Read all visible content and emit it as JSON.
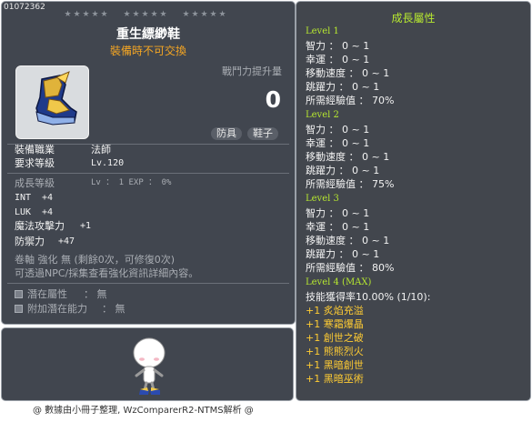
{
  "item": {
    "id": "01072362",
    "name": "重生縹緲鞋",
    "trade_note": "裝備時不可交換",
    "icon": "boots-icon",
    "power_label": "戰鬥力提升量",
    "power_value": "0",
    "tags": [
      "防具",
      "鞋子"
    ]
  },
  "requirements": {
    "job_label": "裝備職業",
    "job_value": "法師",
    "level_label": "要求等級",
    "level_value": "Lv.120"
  },
  "growth_summary": {
    "label": "成長等級",
    "value": "Lv ： 1   EXP ： 0%"
  },
  "stats": [
    {
      "name": "INT",
      "value": "+4"
    },
    {
      "name": "LUK",
      "value": "+4"
    },
    {
      "name": "魔法攻擊力",
      "value": "+1"
    },
    {
      "name": "防禦力",
      "value": "+47"
    }
  ],
  "enhance": {
    "line1": "卷軸 強化 無 (剩餘0次，可修復0次)",
    "line2": "可透過NPC/採集查看強化資訊詳細內容。"
  },
  "potentials": [
    {
      "label": "潛在屬性",
      "value": "： 無",
      "icon": "potential-icon"
    },
    {
      "label": "附加潛在能力",
      "value": "： 無",
      "icon": "bonus-potential-icon"
    }
  ],
  "growth": {
    "title": "成長屬性",
    "levels": [
      {
        "level": "Level 1",
        "rows": [
          "智力 ： 0 ~ 1",
          "幸運 ： 0 ~ 1",
          "移動速度 ： 0 ~ 1",
          "跳躍力 ： 0 ~ 1",
          "所需經驗值 ： 70%"
        ]
      },
      {
        "level": "Level 2",
        "rows": [
          "智力 ： 0 ~ 1",
          "幸運 ： 0 ~ 1",
          "移動速度 ： 0 ~ 1",
          "跳躍力 ： 0 ~ 1",
          "所需經驗值 ： 75%"
        ]
      },
      {
        "level": "Level 3",
        "rows": [
          "智力 ： 0 ~ 1",
          "幸運 ： 0 ~ 1",
          "移動速度 ： 0 ~ 1",
          "跳躍力 ： 0 ~ 1",
          "所需經驗值 ： 80%"
        ]
      }
    ],
    "max_level": "Level 4 (MAX)",
    "skill_rate": "技能獲得率10.00% (1/10):",
    "skills": [
      "+1 炙焰充溢",
      "+1 寒霜爆晶",
      "+1 創世之破",
      "+1 熊熊烈火",
      "+1 黑暗創世",
      "+1 黑暗巫術"
    ]
  },
  "footer": "@ 數據由小冊子整理, WzComparerR2-NTMS解析 @"
}
